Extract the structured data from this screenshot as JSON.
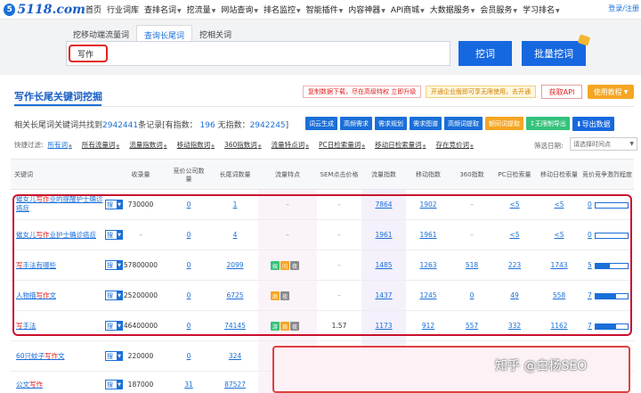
{
  "logo": {
    "text": "5118.com"
  },
  "nav": {
    "items": [
      {
        "label": "首页",
        "caret": false
      },
      {
        "label": "行业词库",
        "caret": false
      },
      {
        "label": "查排名词",
        "caret": true
      },
      {
        "label": "挖流量",
        "caret": true
      },
      {
        "label": "网站查询",
        "caret": true
      },
      {
        "label": "排名监控",
        "caret": true
      },
      {
        "label": "智能插件",
        "caret": true
      },
      {
        "label": "内容神器",
        "caret": true
      },
      {
        "label": "API商城",
        "caret": true
      },
      {
        "label": "大数据服务",
        "caret": true
      },
      {
        "label": "会员服务",
        "caret": true
      },
      {
        "label": "学习排名",
        "caret": true
      }
    ],
    "login": "登录/注册"
  },
  "tabs": [
    "挖移动端流量词",
    "查询长尾词",
    "挖相关词"
  ],
  "active_tab": 1,
  "search": {
    "value": "写作"
  },
  "buttons": {
    "dig": "挖词",
    "batch": "批量挖词"
  },
  "section": {
    "title": "写作长尾关键词挖掘",
    "tag_red": "复制数据下载，尽在高级特权 立即升级",
    "tag_yellow": "开通企业版即可享无限使用，去开通",
    "api": "获取API",
    "tutorial": "使用教程"
  },
  "summary": {
    "prefix": "相关长尾词关键词共找到",
    "total": "2942441",
    "middle": "条记录[有指数：",
    "with_index": "196",
    "no_index_label": "无指数：",
    "no_index": "2942245",
    "suffix": "]"
  },
  "toolbar": [
    {
      "label": "词云生成",
      "style": "blue"
    },
    {
      "label": "高频需求",
      "style": "blue"
    },
    {
      "label": "需求规划",
      "style": "blue"
    },
    {
      "label": "需求图谱",
      "style": "blue"
    },
    {
      "label": "高频词提取",
      "style": "blue"
    },
    {
      "label": "额同词提取",
      "style": "orange"
    },
    {
      "label": "无限制导出",
      "style": "green"
    },
    {
      "label": "导出数据",
      "style": "bigblue"
    }
  ],
  "filters": {
    "label": "快捷过滤:",
    "items": [
      "所有词",
      "所有流量词",
      "流量指数词",
      "移动指数词",
      "360指数词",
      "流量特点词",
      "PC日检索量词",
      "移动日检索量词",
      "存在竞价词"
    ],
    "date_label": "筛选日期:",
    "date_value": "请选择时间点"
  },
  "columns": [
    "关键词",
    "收录量",
    "竞价公司数量",
    "长尾词数量",
    "流量特点",
    "SEM点击价格",
    "流量指数",
    "移动指数",
    "360指数",
    "PC日检索量",
    "移动日检索量",
    "竞价竞争激烈程度"
  ],
  "rows": [
    {
      "keyword_pre": "催女儿",
      "keyword_hl": "写作",
      "keyword_post": "业的提醒护士确诊癌症",
      "sou": "搜",
      "indexed": "730000",
      "companies": "0",
      "longtail": "1",
      "traits": [],
      "traits_text": "–",
      "sem": "–",
      "flow": "7864",
      "mobile": "1902",
      "i360": "–",
      "pc_daily": "<5",
      "mobile_daily": "<5",
      "competition": "0",
      "competition_level": 0.0
    },
    {
      "keyword_pre": "催女儿",
      "keyword_hl": "写作",
      "keyword_post": "业护士确诊癌症",
      "sou": "搜",
      "indexed": "–",
      "companies": "0",
      "longtail": "4",
      "traits": [],
      "traits_text": "–",
      "sem": "–",
      "flow": "1961",
      "mobile": "1961",
      "i360": "–",
      "pc_daily": "<5",
      "mobile_daily": "<5",
      "competition": "0",
      "competition_level": 0.0
    },
    {
      "keyword_pre": "",
      "keyword_hl": "写",
      "keyword_post": "手法有哪些",
      "sou": "搜",
      "indexed": "57800000",
      "companies": "0",
      "longtail": "2099",
      "traits": [
        "娱",
        "问",
        "夜"
      ],
      "traits_text": "",
      "sem": "–",
      "flow": "1485",
      "mobile": "1263",
      "i360": "518",
      "pc_daily": "223",
      "mobile_daily": "1743",
      "competition": "5",
      "competition_level": 0.45
    },
    {
      "keyword_pre": "人物描",
      "keyword_hl": "写作",
      "keyword_post": "文",
      "sou": "搜",
      "indexed": "25200000",
      "companies": "0",
      "longtail": "6725",
      "traits": [
        "周",
        "夜"
      ],
      "traits_text": "",
      "sem": "–",
      "flow": "1437",
      "mobile": "1245",
      "i360": "0",
      "pc_daily": "49",
      "mobile_daily": "558",
      "competition": "7",
      "competition_level": 0.65
    },
    {
      "keyword_pre": "",
      "keyword_hl": "写",
      "keyword_post": "手法",
      "sou": "搜",
      "indexed": "46400000",
      "companies": "0",
      "longtail": "74145",
      "traits": [
        "游",
        "周",
        "夜"
      ],
      "traits_text": "",
      "sem": "1.57",
      "flow": "1173",
      "mobile": "912",
      "i360": "557",
      "pc_daily": "332",
      "mobile_daily": "1162",
      "competition": "7",
      "competition_level": 0.65
    },
    {
      "keyword_pre": "60只蚊子",
      "keyword_hl": "写作",
      "keyword_post": "文",
      "sou": "搜",
      "indexed": "220000",
      "companies": "0",
      "longtail": "324",
      "traits": [],
      "traits_text": "",
      "sem": "",
      "flow": "",
      "mobile": "",
      "i360": "",
      "pc_daily": "",
      "mobile_daily": "",
      "competition": "",
      "competition_level": 0.0
    },
    {
      "keyword_pre": "公文",
      "keyword_hl": "写作",
      "keyword_post": "",
      "sou": "搜",
      "indexed": "187000",
      "companies": "31",
      "longtail": "87527",
      "traits": [],
      "traits_text": "",
      "sem": "",
      "flow": "",
      "mobile": "",
      "i360": "",
      "pc_daily": "",
      "mobile_daily": "",
      "competition": "",
      "competition_level": 0.0
    }
  ],
  "watermark": "知乎 @白杨SEO",
  "colors": {
    "accent": "#1a6fd8",
    "highlight": "#e02020",
    "annotation": "#c8102e",
    "orange": "#f5a623",
    "green": "#34c17b"
  }
}
